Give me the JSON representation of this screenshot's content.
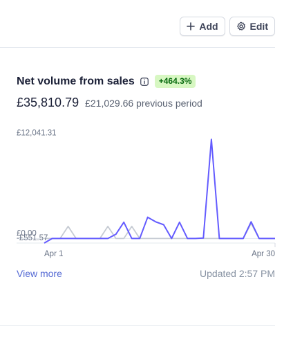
{
  "toolbar": {
    "add_label": "Add",
    "edit_label": "Edit"
  },
  "card": {
    "title": "Net volume from sales",
    "badge": "+464.3%",
    "value": "£35,810.79",
    "previous": "£21,029.66 previous period",
    "view_more": "View more",
    "updated": "Updated 2:57 PM"
  },
  "colors": {
    "current": "#635bff",
    "previous": "#c6cbd3",
    "badge_bg": "#d7f7c2",
    "badge_fg": "#05690d",
    "link": "#5469d4"
  },
  "chart_data": {
    "type": "line",
    "ylim": [
      -551.57,
      12041.31
    ],
    "y_tick_labels": [
      "£12,041.31",
      "£0.00",
      "-£551.57"
    ],
    "y_ticks": [
      12041.31,
      0,
      -551.57
    ],
    "x_tick_labels": [
      "Apr 1",
      "Apr 30"
    ],
    "x": [
      1,
      2,
      3,
      4,
      5,
      6,
      7,
      8,
      9,
      10,
      11,
      12,
      13,
      14,
      15,
      16,
      17,
      18,
      19,
      20,
      21,
      22,
      23,
      24,
      25,
      26,
      27,
      28,
      29,
      30
    ],
    "series": [
      {
        "role": "current",
        "values": [
          -551.57,
          0,
          0,
          0,
          0,
          0,
          0,
          0,
          0,
          500,
          1950,
          0,
          0,
          2550,
          2000,
          1650,
          0,
          1950,
          0,
          0,
          50,
          11900,
          0,
          0,
          0,
          0,
          2000,
          0,
          0,
          0
        ]
      },
      {
        "role": "previous",
        "values": [
          0,
          0,
          0,
          1450,
          0,
          0,
          0,
          0,
          1450,
          0,
          0,
          1450,
          0,
          0,
          0,
          0,
          0,
          0,
          0,
          0,
          0,
          0,
          0,
          0,
          0,
          0,
          1800,
          0,
          0,
          0
        ]
      }
    ]
  }
}
